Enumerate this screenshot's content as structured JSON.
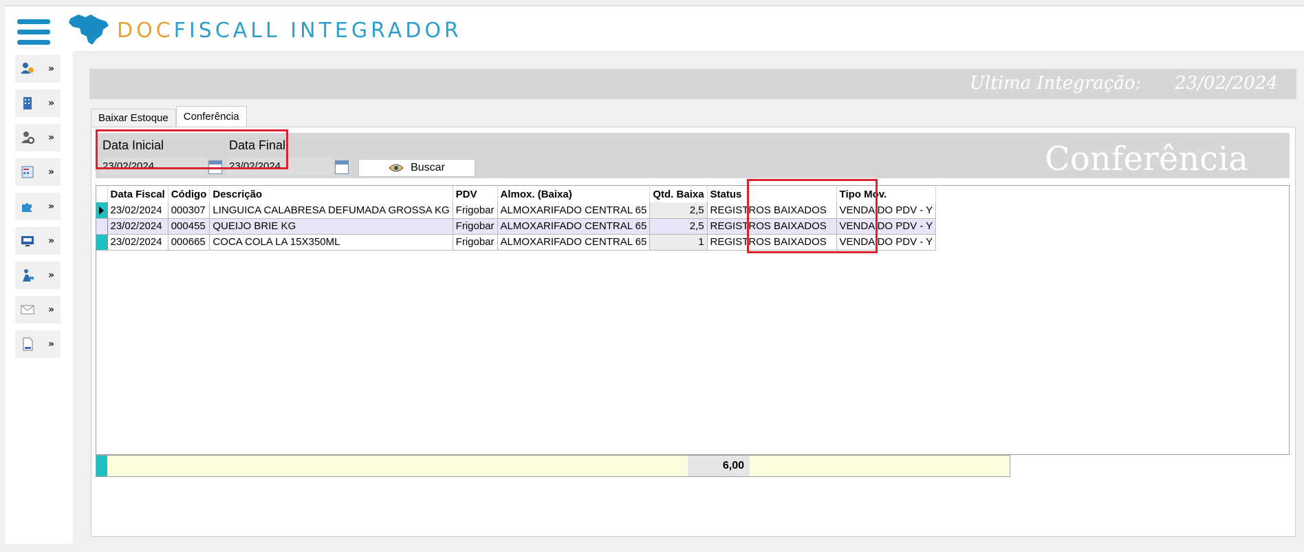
{
  "app": {
    "title_part1": "DOC",
    "title_part2": "FISCALL INTEGRADOR"
  },
  "sidebar": {
    "items": [
      {
        "icon": "users-icon"
      },
      {
        "icon": "building-icon"
      },
      {
        "icon": "user-settings-icon"
      },
      {
        "icon": "calculator-report-icon"
      },
      {
        "icon": "puzzle-icon"
      },
      {
        "icon": "pdv-screen-icon"
      },
      {
        "icon": "worker-icon"
      },
      {
        "icon": "mail-icon"
      },
      {
        "icon": "document-icon"
      }
    ]
  },
  "header": {
    "last_integration_label": "Ultima Integração:",
    "last_integration_value": "23/02/2024"
  },
  "tabs": [
    {
      "label": "Baixar Estoque",
      "active": false
    },
    {
      "label": "Conferência",
      "active": true
    }
  ],
  "filters": {
    "start_label": "Data Inicial",
    "start_value": "23/02/2024",
    "end_label": "Data Final",
    "end_value": "23/02/2024",
    "search_button": "Buscar"
  },
  "section_title": "Conferência",
  "grid": {
    "columns": [
      "Data Fiscal",
      "Código",
      "Descrição",
      "PDV",
      "Almox. (Baixa)",
      "Qtd. Baixa",
      "Status",
      "Tipo Mov."
    ],
    "rows": [
      [
        "23/02/2024",
        "000307",
        "LINGUICA CALABRESA DEFUMADA GROSSA KG",
        "Frigobar",
        "ALMOXARIFADO CENTRAL 65",
        "2,5",
        "REGISTROS BAIXADOS",
        "VENDA DO PDV - Y"
      ],
      [
        "23/02/2024",
        "000455",
        "QUEIJO BRIE KG",
        "Frigobar",
        "ALMOXARIFADO CENTRAL 65",
        "2,5",
        "REGISTROS BAIXADOS",
        "VENDA DO PDV - Y"
      ],
      [
        "23/02/2024",
        "000665",
        "COCA COLA LA 15X350ML",
        "Frigobar",
        "ALMOXARIFADO CENTRAL 65",
        "1",
        "REGISTROS BAIXADOS",
        "VENDA DO PDV - Y"
      ]
    ],
    "total": "6,00"
  },
  "colors": {
    "accent_blue": "#2a9fd0",
    "accent_orange": "#e8a030",
    "highlight_red": "#d9232e",
    "indicator_teal": "#20c0c0"
  }
}
